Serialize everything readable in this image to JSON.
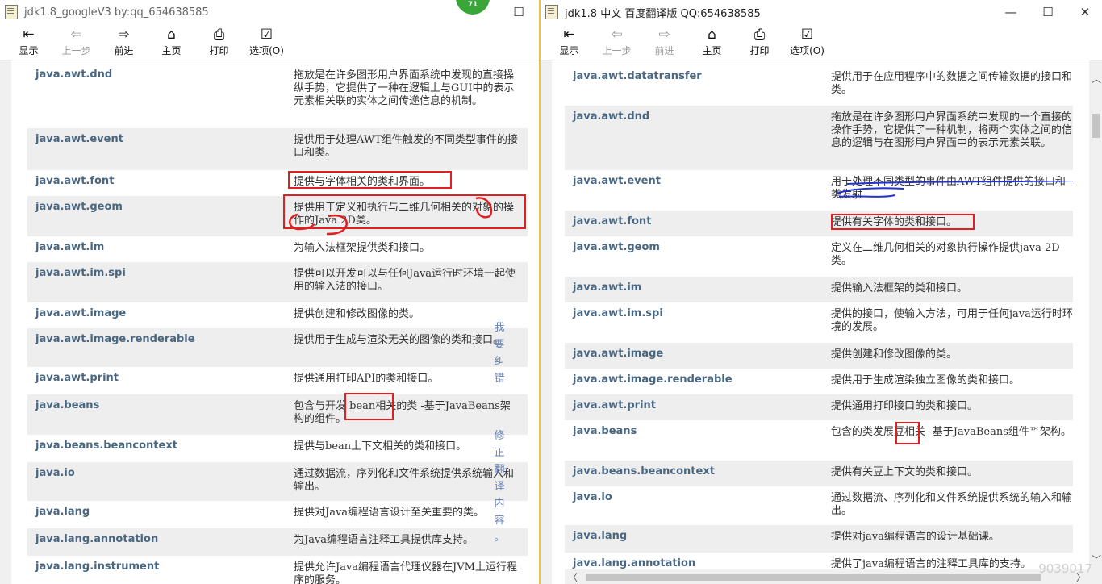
{
  "left": {
    "title": "jdk1.8_googleV3 by:qq_654638585",
    "badge": "71",
    "controls": [
      "☐"
    ],
    "toolbar": [
      {
        "label": "显示",
        "icon": "show-icon",
        "glyph": "⇤",
        "enabled": true
      },
      {
        "label": "上一步",
        "icon": "back-arrow-icon",
        "glyph": "⇦",
        "enabled": false
      },
      {
        "label": "前进",
        "icon": "forward-arrow-icon",
        "glyph": "⇨",
        "enabled": true
      },
      {
        "label": "主页",
        "icon": "home-icon",
        "glyph": "⌂",
        "enabled": true
      },
      {
        "label": "打印",
        "icon": "printer-icon",
        "glyph": "⎙",
        "enabled": true
      },
      {
        "label": "选项(O)",
        "icon": "options-icon",
        "glyph": "☑",
        "enabled": true
      }
    ],
    "rows": [
      {
        "pkg": "java.awt.dnd",
        "desc": "拖放是在许多图形用户界面系统中发现的直接操纵手势，它提供了一种在逻辑上与GUI中的表示元素相关联的实体之间传递信息的机制。"
      },
      {
        "pkg": "java.awt.event",
        "desc": "提供用于处理AWT组件触发的不同类型事件的接口和类。"
      },
      {
        "pkg": "java.awt.font",
        "desc": "提供与字体相关的类和界面。"
      },
      {
        "pkg": "java.awt.geom",
        "desc": "提供用于定义和执行与二维几何相关的对象的操作的Java 2D类。"
      },
      {
        "pkg": "java.awt.im",
        "desc": "为输入法框架提供类和接口。"
      },
      {
        "pkg": "java.awt.im.spi",
        "desc": "提供可以开发可以与任何Java运行时环境一起使用的输入法的接口。"
      },
      {
        "pkg": "java.awt.image",
        "desc": "提供创建和修改图像的类。"
      },
      {
        "pkg": "java.awt.image.renderable",
        "desc": "提供用于生成与渲染无关的图像的类和接口。"
      },
      {
        "pkg": "java.awt.print",
        "desc": "提供通用打印API的类和接口。"
      },
      {
        "pkg": "java.beans",
        "desc": "包含与开发 bean相关的类 -基于JavaBeans架构的组件。"
      },
      {
        "pkg": "java.beans.beancontext",
        "desc": "提供与bean上下文相关的类和接口。"
      },
      {
        "pkg": "java.io",
        "desc": "通过数据流，序列化和文件系统提供系统输入和输出。"
      },
      {
        "pkg": "java.lang",
        "desc": "提供对Java编程语言设计至关重要的类。"
      },
      {
        "pkg": "java.lang.annotation",
        "desc": "为Java编程语言注释工具提供库支持。"
      },
      {
        "pkg": "java.lang.instrument",
        "desc": "提供允许Java编程语言代理仪器在JVM上运行程序的服务。"
      }
    ],
    "feedback_chars": [
      "我",
      "要",
      "纠",
      "错",
      "修",
      "正",
      "翻",
      "译",
      "内",
      "容",
      "。"
    ]
  },
  "right": {
    "title": "jdk1.8 中文 百度翻译版 QQ:654638585",
    "controls": [
      "—",
      "☐",
      "✕"
    ],
    "toolbar": [
      {
        "label": "显示",
        "icon": "show-icon",
        "glyph": "⇤",
        "enabled": true
      },
      {
        "label": "上一步",
        "icon": "back-arrow-icon",
        "glyph": "⇦",
        "enabled": false
      },
      {
        "label": "前进",
        "icon": "forward-arrow-icon",
        "glyph": "⇨",
        "enabled": false
      },
      {
        "label": "主页",
        "icon": "home-icon",
        "glyph": "⌂",
        "enabled": true
      },
      {
        "label": "打印",
        "icon": "printer-icon",
        "glyph": "⎙",
        "enabled": true
      },
      {
        "label": "选项(O)",
        "icon": "options-icon",
        "glyph": "☑",
        "enabled": true
      }
    ],
    "rows": [
      {
        "pkg": "java.awt.datatransfer",
        "desc": "提供用于在应用程序中的数据之间传输数据的接口和类。"
      },
      {
        "pkg": "java.awt.dnd",
        "desc": "拖放是在许多图形用户界面系统中发现的一个直接的操作手势，它提供了一种机制，将两个实体之间的信息的逻辑与在图形用户界面中的表示元素关联。"
      },
      {
        "pkg": "java.awt.event",
        "desc": "用于处理不同类型的事件由AWT组件提供的接口和类发射"
      },
      {
        "pkg": "java.awt.font",
        "desc": "提供有关字体的类和接口。"
      },
      {
        "pkg": "java.awt.geom",
        "desc": "定义在二维几何相关的对象执行操作提供java 2D类。"
      },
      {
        "pkg": "java.awt.im",
        "desc": "提供输入法框架的类和接口。"
      },
      {
        "pkg": "java.awt.im.spi",
        "desc": "提供的接口，使输入方法，可用于任何java运行时环境的发展。"
      },
      {
        "pkg": "java.awt.image",
        "desc": "提供创建和修改图像的类。"
      },
      {
        "pkg": "java.awt.image.renderable",
        "desc": "提供用于生成渲染独立图像的类和接口。"
      },
      {
        "pkg": "java.awt.print",
        "desc": "提供通用打印接口的类和接口。"
      },
      {
        "pkg": "java.beans",
        "desc": "包含的类发展豆相关--基于JavaBeans组件™架构。"
      },
      {
        "pkg": "java.beans.beancontext",
        "desc": "提供有关豆上下文的类和接口。"
      },
      {
        "pkg": "java.io",
        "desc": "通过数据流、序列化和文件系统提供系统的输入和输出。"
      },
      {
        "pkg": "java.lang",
        "desc": "提供对java编程语言的设计基础课。"
      },
      {
        "pkg": "java.lang.annotation",
        "desc": "提供了java编程语言的注释工具库的支持。"
      }
    ],
    "watermark": "9039017"
  },
  "colors": {
    "package_link": "#4a6782",
    "annotation_red": "#e02020",
    "annotation_blue": "#2233cc",
    "feedback_link": "#6a84b8"
  }
}
